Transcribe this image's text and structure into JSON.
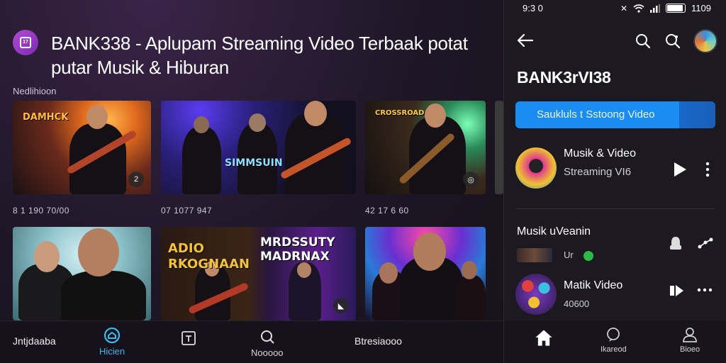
{
  "app": {
    "title": "BANK338 - Aplupam Streaming Video Terbaak potat putar Musik & Hiburan",
    "section_label": "Nedlihioon"
  },
  "videos": [
    {
      "overlay": "DAMHCK",
      "meta": "8 1 190 70/00",
      "badge": "2"
    },
    {
      "overlay": "SIMMSUIN",
      "meta": "07 1077 947",
      "badge": ""
    },
    {
      "overlay": "CROSSROAD",
      "meta": "42 17 6 60",
      "badge": "◎"
    },
    {
      "overlay": "",
      "meta": "",
      "badge": ""
    },
    {
      "overlay": "ADIO RKOGNAAN",
      "meta": "",
      "badge": ""
    },
    {
      "overlay": "MRDSSUTY MADRNAX",
      "meta": "",
      "badge": "◣"
    },
    {
      "overlay": "",
      "meta": "",
      "badge": ""
    }
  ],
  "bottom_nav": {
    "left_text": "Jntjdaaba",
    "home_label": "Hicien",
    "search_label": "Nooooo",
    "right_text": "Btresiaooo"
  },
  "phone": {
    "status_time": "9:3 0",
    "status_battery": "1109",
    "title": "BANK3rVI38",
    "cta_label": "Saukluls t Sstoong Video",
    "items": [
      {
        "title": "Musik & Video",
        "subtitle": "Streaming VI6"
      },
      {
        "title": "Musik uVeanin",
        "subtitle": "Ur"
      },
      {
        "title": "Matik Video",
        "subtitle": "40600"
      }
    ],
    "nav": {
      "search_label": "Ikareod",
      "profile_label": "Bioeo"
    }
  },
  "colors": {
    "accent": "#1b8cf2",
    "brand": "#a848d2",
    "nav_active": "#3fb7e8"
  }
}
